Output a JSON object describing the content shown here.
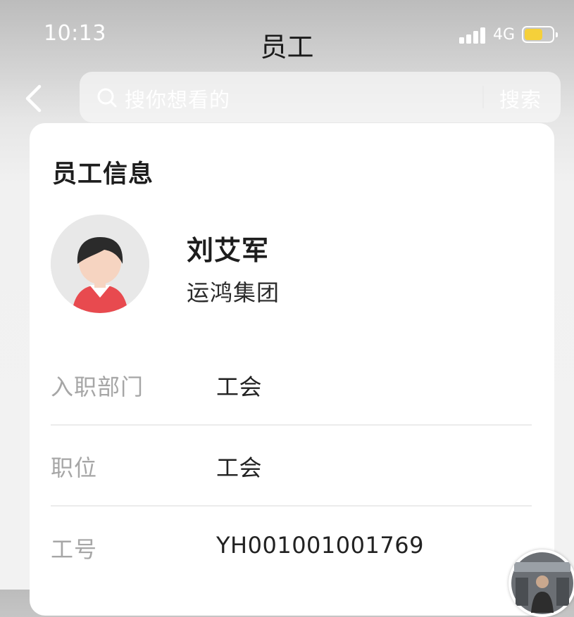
{
  "status_bar": {
    "time": "10:13",
    "network": "4G",
    "battery_level": 0.6
  },
  "header": {
    "title": "员工"
  },
  "search": {
    "placeholder": "搜你想看的",
    "button_label": "搜索"
  },
  "card": {
    "title": "员工信息",
    "employee": {
      "name": "刘艾军",
      "company": "运鸿集团"
    },
    "fields": [
      {
        "label": "入职部门",
        "value": "工会"
      },
      {
        "label": "职位",
        "value": "工会"
      },
      {
        "label": "工号",
        "value": "YH001001001769"
      }
    ]
  },
  "colors": {
    "avatar_shirt": "#e84a4f",
    "avatar_hair": "#2b2b2b",
    "battery": "#f5d03a"
  },
  "icons": {
    "back": "chevron-left-icon",
    "search": "search-icon"
  }
}
